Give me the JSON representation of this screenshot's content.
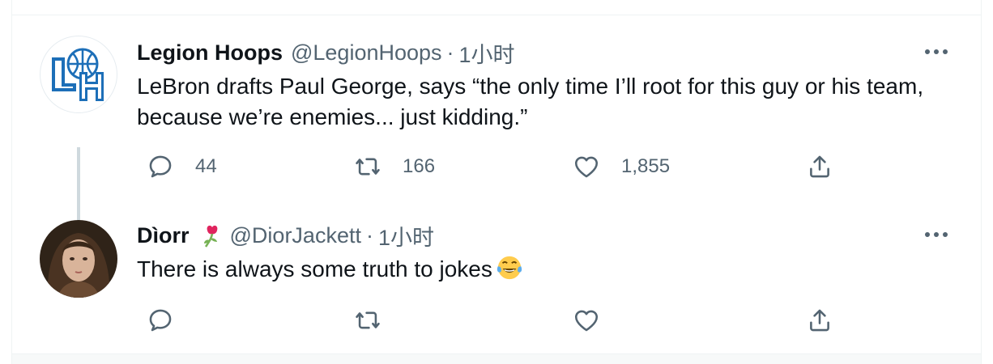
{
  "tweets": [
    {
      "name": "Legion Hoops",
      "handle": "@LegionHoops",
      "separator": "·",
      "time": "1小时",
      "text": "LeBron drafts Paul George, says “the only time I’ll root for this guy or his team, because we’re enemies... just kidding.”",
      "avatar_text": "LH",
      "replies": "44",
      "retweets": "166",
      "likes": "1,855"
    },
    {
      "name": "Dìorr",
      "handle": "@DiorJackett",
      "separator": "·",
      "time": "1小时",
      "text": "There is always some truth to jokes"
    }
  ],
  "icons": {
    "more": "more-dots-icon",
    "reply": "reply-icon",
    "retweet": "retweet-icon",
    "like": "heart-icon",
    "share": "share-icon",
    "name_emoji": "wilted-rose-icon",
    "text_emoji": "tears-of-joy-icon"
  },
  "colors": {
    "text_primary": "#0f1419",
    "text_secondary": "#536471",
    "thread_line": "#cfd9de",
    "brand_blue": "#1d6fb8"
  }
}
